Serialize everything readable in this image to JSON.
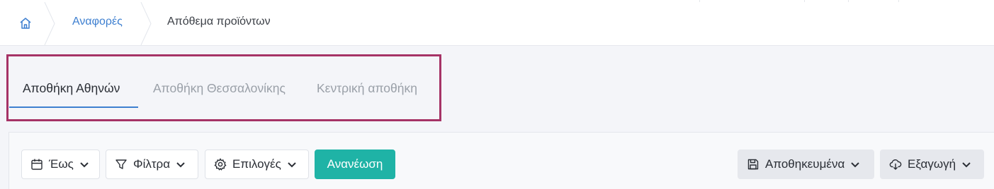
{
  "breadcrumb": {
    "home_icon": "home-icon",
    "items": [
      "Αναφορές"
    ],
    "current": "Απόθεμα προϊόντων"
  },
  "tabs": [
    {
      "label": "Αποθήκη Αθηνών",
      "active": true
    },
    {
      "label": "Αποθήκη Θεσσαλονίκης",
      "active": false
    },
    {
      "label": "Κεντρική αποθήκη",
      "active": false
    }
  ],
  "toolbar": {
    "date_label": "Έως",
    "filters_label": "Φίλτρα",
    "options_label": "Επιλογές",
    "refresh_label": "Ανανέωση",
    "saved_label": "Αποθηκευμένα",
    "export_label": "Εξαγωγή"
  },
  "colors": {
    "accent": "#3d7fd0",
    "primary_button": "#1fb3a6",
    "highlight_border": "#a63366"
  }
}
